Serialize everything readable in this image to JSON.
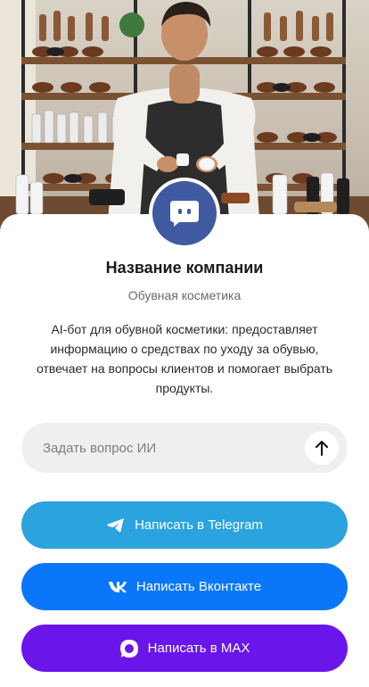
{
  "hero": {
    "image": "shoe-shop-barista-photo"
  },
  "company": {
    "avatar_icon": "chat-bot-icon",
    "name": "Название компании",
    "subtitle": "Обувная косметика",
    "description": "AI-бот для обувной косметики: предоставляет информацию о средствах по уходу за обувью, отвечает на вопросы клиентов и помогает выбрать продукты."
  },
  "ask": {
    "placeholder": "Задать вопрос ИИ",
    "value": "",
    "send_icon": "arrow-up-icon"
  },
  "actions": {
    "telegram": {
      "label": "Написать в Telegram",
      "icon": "telegram-icon",
      "color": "#2aa3df"
    },
    "vk": {
      "label": "Написать Вконтакте",
      "icon": "vk-icon",
      "color": "#0a77fb"
    },
    "max": {
      "label": "Написать в MAX",
      "icon": "max-icon",
      "color": "#6a16ea"
    }
  },
  "colors": {
    "avatar": "#3f5aa0",
    "input_bg": "#efeff1"
  }
}
